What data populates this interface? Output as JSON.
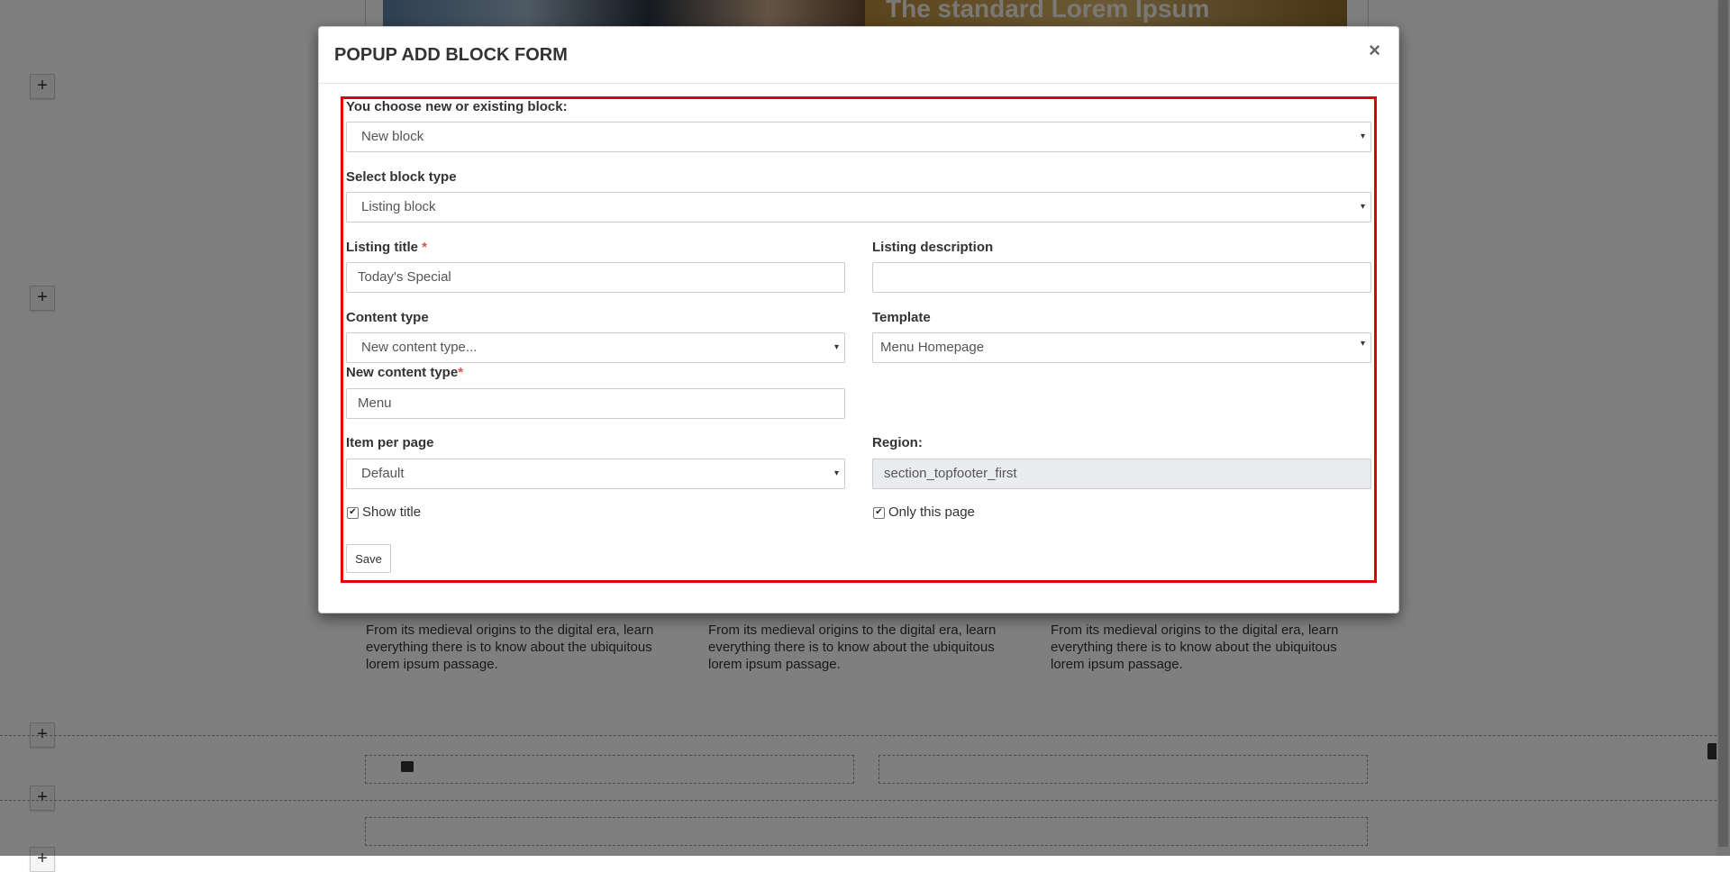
{
  "background": {
    "hero_title": "The standard Lorem Ipsum",
    "add_button_label": "+",
    "card_texts": [
      "From its medieval origins to the digital era, learn everything there is to know about the ubiquitous lorem ipsum passage.",
      "From its medieval origins to the digital era, learn everything there is to know about the ubiquitous lorem ipsum passage.",
      "From its medieval origins to the digital era, learn everything there is to know about the ubiquitous lorem ipsum passage."
    ]
  },
  "modal": {
    "title": "POPUP ADD BLOCK FORM",
    "close_label": "×",
    "form": {
      "block_choice": {
        "label": "You choose new or existing block:",
        "value": "New block"
      },
      "block_type": {
        "label": "Select block type",
        "value": "Listing block"
      },
      "listing_title": {
        "label": "Listing title ",
        "required_mark": "*",
        "value": "Today's Special"
      },
      "listing_description": {
        "label": "Listing description",
        "value": ""
      },
      "content_type": {
        "label": "Content type",
        "value": "New content type..."
      },
      "template": {
        "label": "Template",
        "value": "Menu Homepage"
      },
      "new_content_type": {
        "label": "New content type",
        "required_mark": "*",
        "value": "Menu"
      },
      "item_per_page": {
        "label": "Item per page",
        "value": "Default"
      },
      "region": {
        "label": "Region:",
        "value": "section_topfooter_first"
      },
      "show_title": {
        "label": "Show title",
        "checked": true,
        "mark": "✔"
      },
      "only_this_page": {
        "label": "Only this page",
        "checked": true,
        "mark": "✔"
      },
      "save_label": "Save"
    }
  },
  "colors": {
    "highlight_border": "#e00000",
    "required": "#d9534f",
    "overlay": "rgba(0,0,0,0.5)"
  },
  "icons": {
    "caret": "▾",
    "close": "×",
    "add": "+"
  }
}
